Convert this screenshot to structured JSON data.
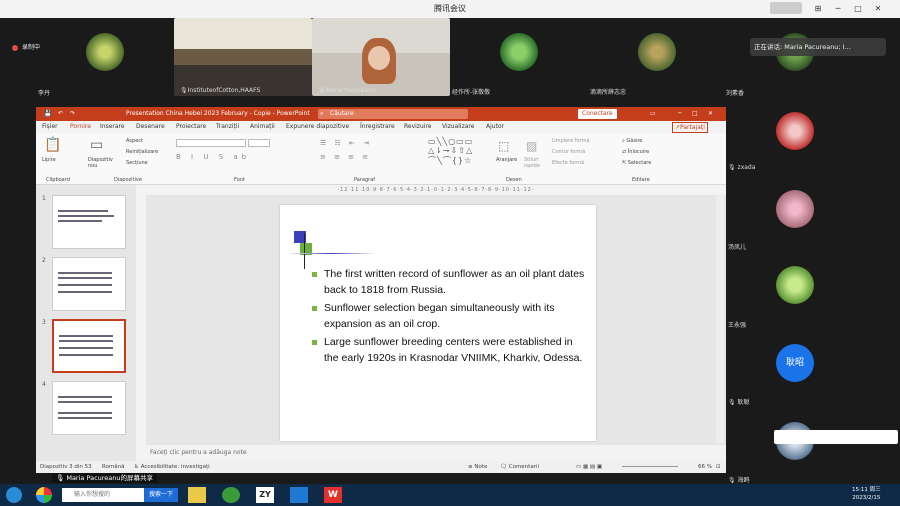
{
  "app": {
    "title": "腾讯会议"
  },
  "recording": {
    "label": "录制中"
  },
  "speaking": {
    "label": "正在讲话: Maria Pacureanu; I..."
  },
  "participants": {
    "p1": "李丹",
    "p2": "InstituteofCotton,HAAFS",
    "p3": "Maria Pacureanu",
    "p4": "经作所-张敬敬",
    "p5": "滴滴所薛志忠",
    "p6": "刘素香",
    "side": [
      "zxada",
      "汤凤儿",
      "王永强",
      "耿聪",
      "海鸥"
    ],
    "avatar_text": "耿昭"
  },
  "ppt": {
    "window_title": "Presentation China Hebei 2023 February - Copie  -  PowerPoint",
    "user": "Maria Pacureanu",
    "search": "Căutare",
    "connect": "Conectare",
    "tabs": [
      "Fișier",
      "Pornire",
      "Inserare",
      "Desenare",
      "Proiectare",
      "Tranziții",
      "Animații",
      "Expunere diapozitive",
      "Înregistrare",
      "Revizuire",
      "Vizualizare",
      "Ajutor"
    ],
    "share": "Partajați",
    "groups": [
      "Clipboard",
      "Diapozitive",
      "Font",
      "Paragraf",
      "Desen",
      "Editare"
    ],
    "ribbon_items": {
      "paste": "Lipire",
      "new_slide": "Diapozitiv nou",
      "layout": "Aspect",
      "reset": "Reinițializare",
      "section": "Secțiune",
      "arrange": "Aranjare",
      "styles": "Stiluri rapide",
      "fill": "Umplere formă",
      "outline": "Contur formă",
      "effects": "Efecte formă",
      "find": "Găsire",
      "replace": "Înlocuire",
      "select": "Selectare"
    },
    "slide_bullets": [
      "The first written record of sunflower as an oil plant dates back to 1818 from Russia.",
      "Sunflower selection began simultaneously with its expansion as an oil crop.",
      "Large sunflower breeding centers were established in the early 1920s  in Krasnodar VNIIMK, Kharkiv, Odessa."
    ],
    "notes": "Faceți clic pentru a adăuga note",
    "status": {
      "slide": "Diapozitiv 3 din 53",
      "lang": "Română",
      "access": "Accesibilitate: investigați",
      "notes_btn": "Note",
      "comments_btn": "Comentarii",
      "zoom": "66 %"
    },
    "thumb_numbers": [
      "1",
      "2",
      "3",
      "4"
    ]
  },
  "share_label": "Maria Pacureanu的屏幕共享",
  "taskbar": {
    "input_placeholder": "输入你想搜的",
    "search_btn": "搜索一下",
    "time": "15:11 周三",
    "date": "2023/2/15"
  }
}
